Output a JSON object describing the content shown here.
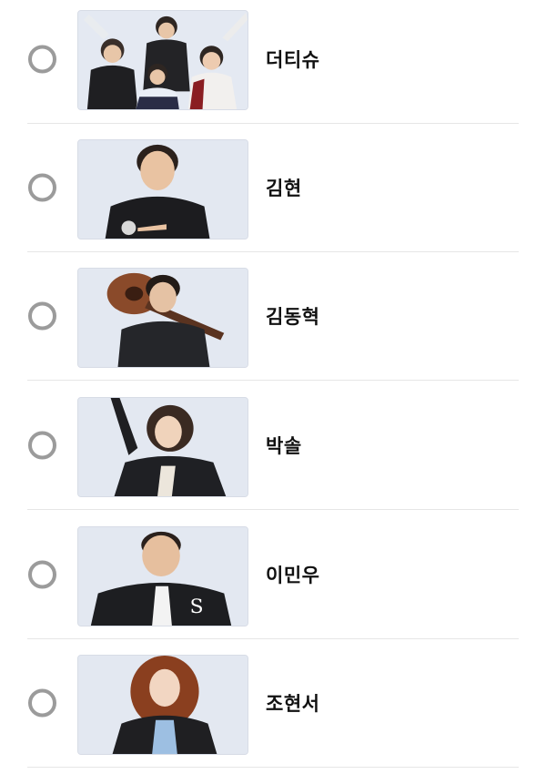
{
  "options": [
    {
      "label": "더티슈",
      "photo": "group-photo"
    },
    {
      "label": "김현",
      "photo": "portrait-photo"
    },
    {
      "label": "김동혁",
      "photo": "portrait-photo-guitar"
    },
    {
      "label": "박솔",
      "photo": "portrait-photo"
    },
    {
      "label": "이민우",
      "photo": "portrait-photo"
    },
    {
      "label": "조현서",
      "photo": "portrait-photo"
    }
  ],
  "colors": {
    "radio_border": "#9b9b9b",
    "divider": "#e6e6e6",
    "photo_background": "#e3e8f1",
    "label_text": "#111111"
  }
}
